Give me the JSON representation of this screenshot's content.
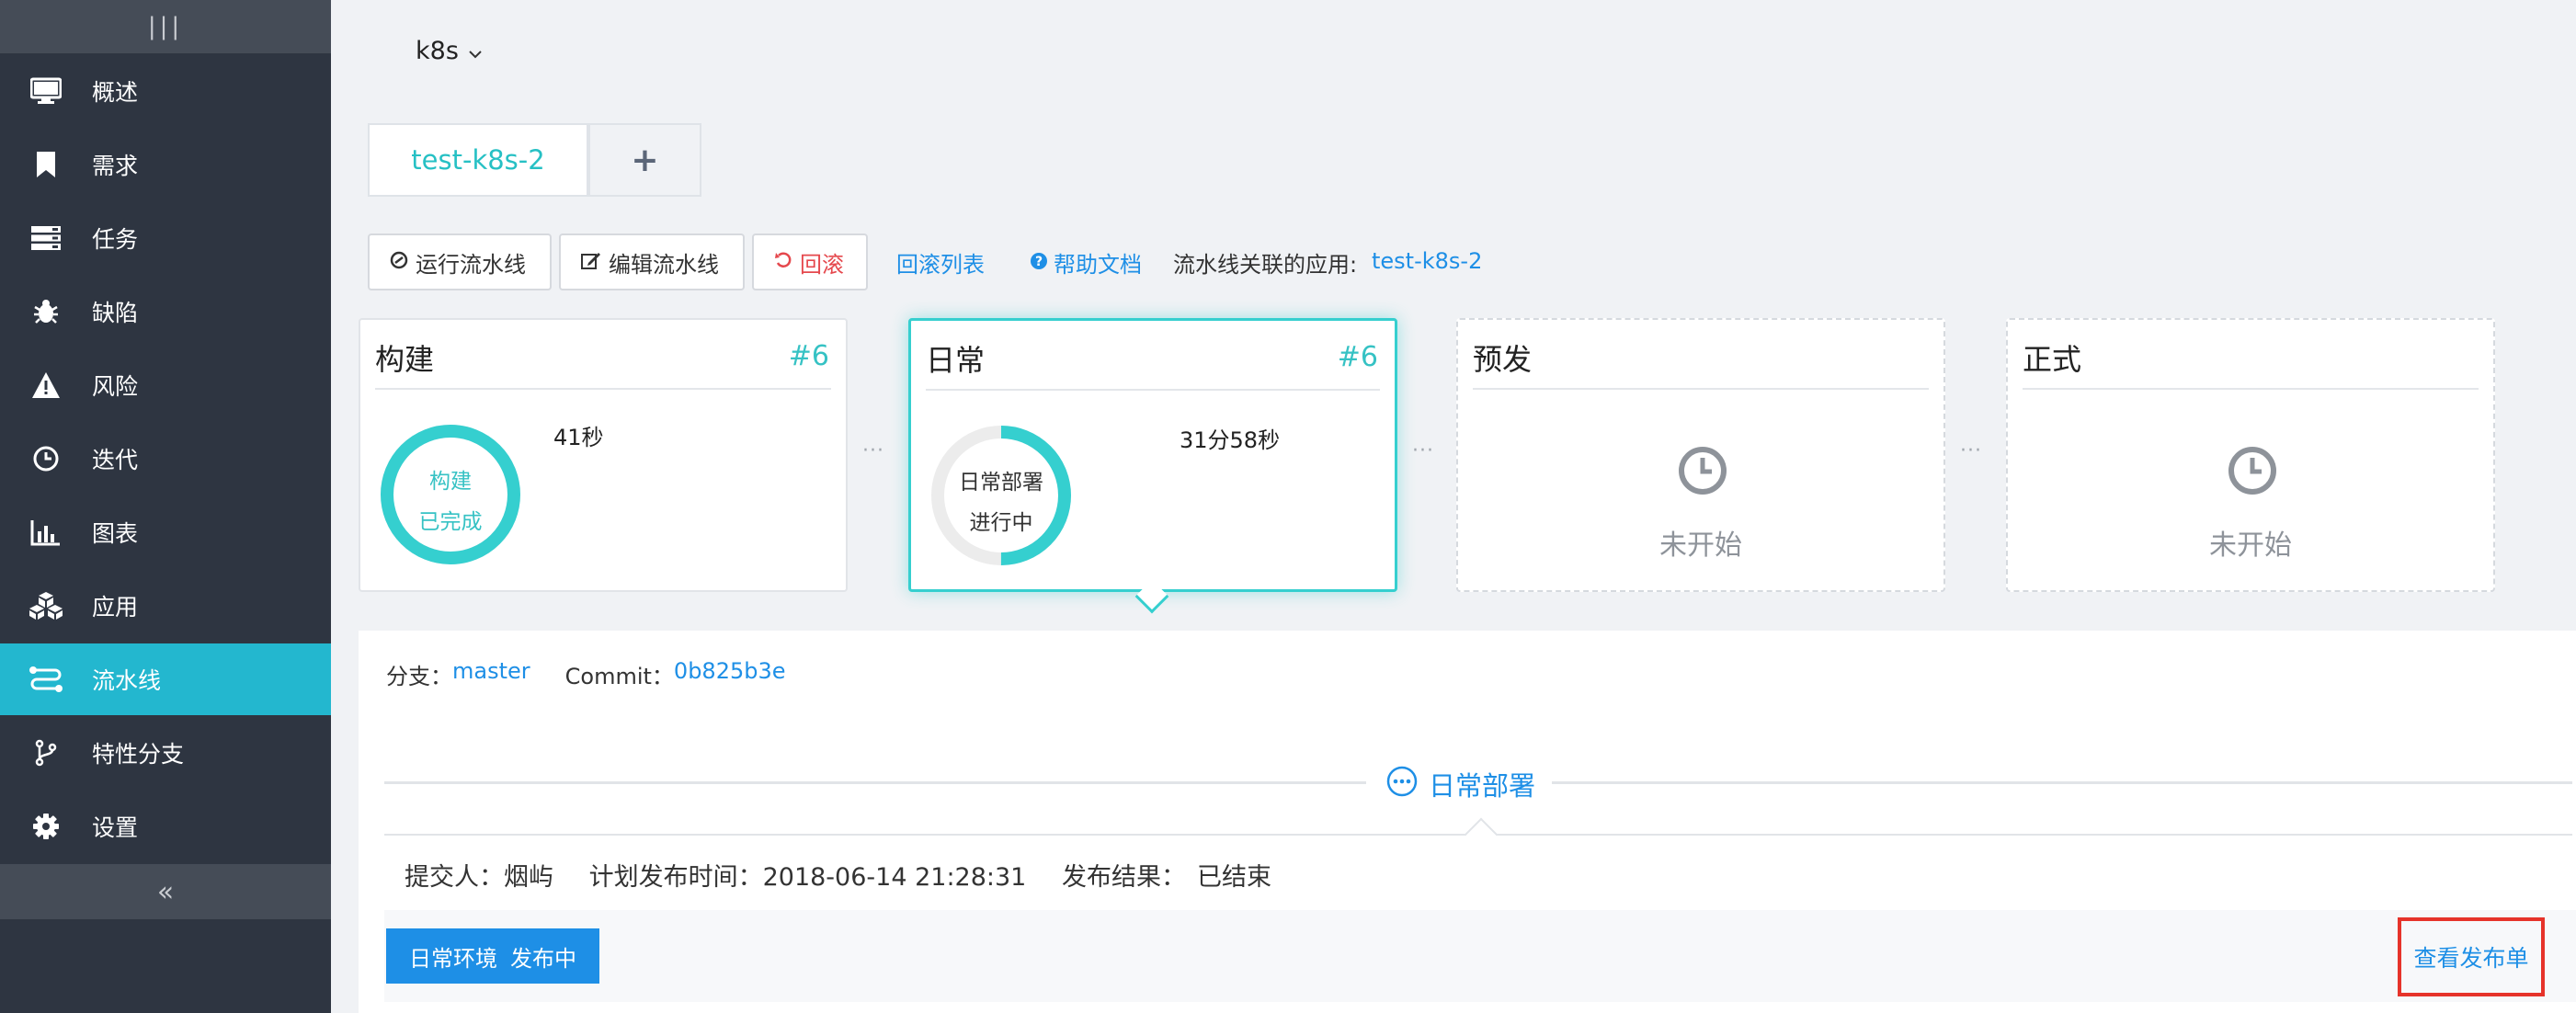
{
  "sidebar": {
    "toggle_glyph": "|||",
    "items": [
      {
        "label": "概述",
        "icon": "monitor-icon"
      },
      {
        "label": "需求",
        "icon": "bookmark-icon"
      },
      {
        "label": "任务",
        "icon": "list-icon"
      },
      {
        "label": "缺陷",
        "icon": "bug-icon"
      },
      {
        "label": "风险",
        "icon": "warning-icon"
      },
      {
        "label": "迭代",
        "icon": "clock-icon"
      },
      {
        "label": "图表",
        "icon": "bar-chart-icon"
      },
      {
        "label": "应用",
        "icon": "cubes-icon"
      },
      {
        "label": "流水线",
        "icon": "pipeline-icon"
      },
      {
        "label": "特性分支",
        "icon": "branch-icon"
      },
      {
        "label": "设置",
        "icon": "gear-icon"
      }
    ],
    "active_item": "流水线",
    "collapse_glyph": "«"
  },
  "header": {
    "env_selector": "k8s"
  },
  "tabs": [
    {
      "label": "test-k8s-2"
    },
    {
      "label": "+"
    }
  ],
  "toolbar": {
    "run_label": "运行流水线",
    "edit_label": "编辑流水线",
    "rollback_label": "回滚",
    "rollback_list_label": "回滚列表",
    "help_label": "帮助文档",
    "related_app_prefix": "流水线关联的应用:",
    "related_app": "test-k8s-2"
  },
  "stages": [
    {
      "title": "构建",
      "number": "#6",
      "ring_line1": "构建",
      "ring_line2": "已完成",
      "time": "41秒",
      "progress": 1.0
    },
    {
      "title": "日常",
      "number": "#6",
      "ring_line1": "日常部署",
      "ring_line2": "进行中",
      "time": "31分58秒",
      "progress": 0.5
    },
    {
      "title": "预发",
      "status": "未开始"
    },
    {
      "title": "正式",
      "status": "未开始"
    }
  ],
  "connector_glyph": "···",
  "detail": {
    "branch_label": "分支：",
    "branch": "master",
    "commit_label": "Commit：",
    "commit": "0b825b3e",
    "section_title": "日常部署",
    "submitter_label": "提交人：",
    "submitter": "烟屿",
    "plan_time_label": "计划发布时间：",
    "plan_time": "2018-06-14 21:28:31",
    "result_label": "发布结果：",
    "result": "已结束",
    "env_name": "日常环境",
    "env_status": "发布中",
    "view_order_label": "查看发布单"
  },
  "colors": {
    "sidebar_bg": "#2e3541",
    "sidebar_active": "#23b7cf",
    "accent_teal": "#35cfcf",
    "link_blue": "#1e8fe6",
    "danger": "#e5484d",
    "highlight_box": "#e6332a"
  }
}
